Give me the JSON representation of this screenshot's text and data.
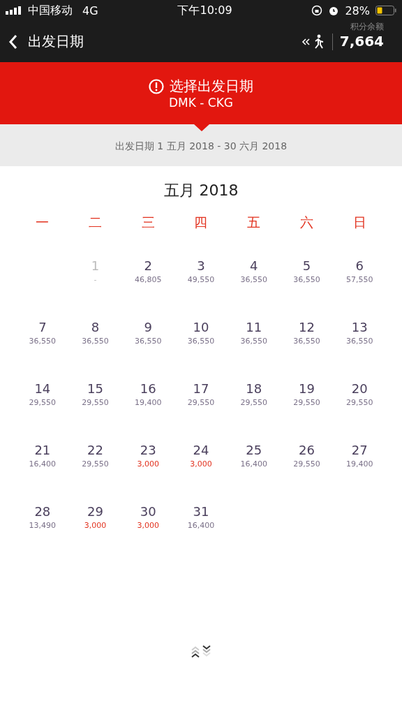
{
  "status_bar": {
    "carrier": "中国移动",
    "network": "4G",
    "time": "下午10:09",
    "battery": "28%"
  },
  "header": {
    "title": "出发日期",
    "points_label": "积分余额",
    "points": "7,664"
  },
  "banner": {
    "title": "选择出发日期",
    "route": "DMK - CKG"
  },
  "range": "出发日期 1 五月  2018 - 30 六月 2018",
  "month": "五月 2018",
  "weekdays": [
    "一",
    "二",
    "三",
    "四",
    "五",
    "六",
    "日"
  ],
  "weeks": [
    {
      "days": [
        {
          "kind": "blank"
        },
        {
          "kind": "day",
          "day": "1",
          "price": "-",
          "disabled": true,
          "low": false
        },
        {
          "day": "2",
          "price": "46,805",
          "disabled": false,
          "low": false
        },
        {
          "day": "3",
          "price": "49,550",
          "disabled": false,
          "low": false
        },
        {
          "day": "4",
          "price": "36,550",
          "disabled": false,
          "low": false
        },
        {
          "day": "5",
          "price": "36,550",
          "disabled": false,
          "low": false
        },
        {
          "day": "6",
          "price": "57,550",
          "disabled": false,
          "low": false
        }
      ]
    },
    {
      "days": [
        {
          "day": "7",
          "price": "36,550",
          "disabled": false,
          "low": false
        },
        {
          "day": "8",
          "price": "36,550",
          "disabled": false,
          "low": false
        },
        {
          "day": "9",
          "price": "36,550",
          "disabled": false,
          "low": false
        },
        {
          "day": "10",
          "price": "36,550",
          "disabled": false,
          "low": false
        },
        {
          "day": "11",
          "price": "36,550",
          "disabled": false,
          "low": false
        },
        {
          "day": "12",
          "price": "36,550",
          "disabled": false,
          "low": false
        },
        {
          "day": "13",
          "price": "36,550",
          "disabled": false,
          "low": false
        }
      ]
    },
    {
      "days": [
        {
          "day": "14",
          "price": "29,550",
          "disabled": false,
          "low": false
        },
        {
          "day": "15",
          "price": "29,550",
          "disabled": false,
          "low": false
        },
        {
          "day": "16",
          "price": "19,400",
          "disabled": false,
          "low": false
        },
        {
          "day": "17",
          "price": "29,550",
          "disabled": false,
          "low": false
        },
        {
          "day": "18",
          "price": "29,550",
          "disabled": false,
          "low": false
        },
        {
          "day": "19",
          "price": "29,550",
          "disabled": false,
          "low": false
        },
        {
          "day": "20",
          "price": "29,550",
          "disabled": false,
          "low": false
        }
      ]
    },
    {
      "days": [
        {
          "day": "21",
          "price": "16,400",
          "disabled": false,
          "low": false
        },
        {
          "day": "22",
          "price": "29,550",
          "disabled": false,
          "low": false
        },
        {
          "day": "23",
          "price": "3,000",
          "disabled": false,
          "low": true
        },
        {
          "day": "24",
          "price": "3,000",
          "disabled": false,
          "low": true
        },
        {
          "day": "25",
          "price": "16,400",
          "disabled": false,
          "low": false
        },
        {
          "day": "26",
          "price": "29,550",
          "disabled": false,
          "low": false
        },
        {
          "day": "27",
          "price": "19,400",
          "disabled": false,
          "low": false
        }
      ]
    },
    {
      "days": [
        {
          "day": "28",
          "price": "13,490",
          "disabled": false,
          "low": false
        },
        {
          "day": "29",
          "price": "3,000",
          "disabled": false,
          "low": true
        },
        {
          "day": "30",
          "price": "3,000",
          "disabled": false,
          "low": true
        },
        {
          "day": "31",
          "price": "16,400",
          "disabled": false,
          "low": false
        }
      ]
    }
  ]
}
